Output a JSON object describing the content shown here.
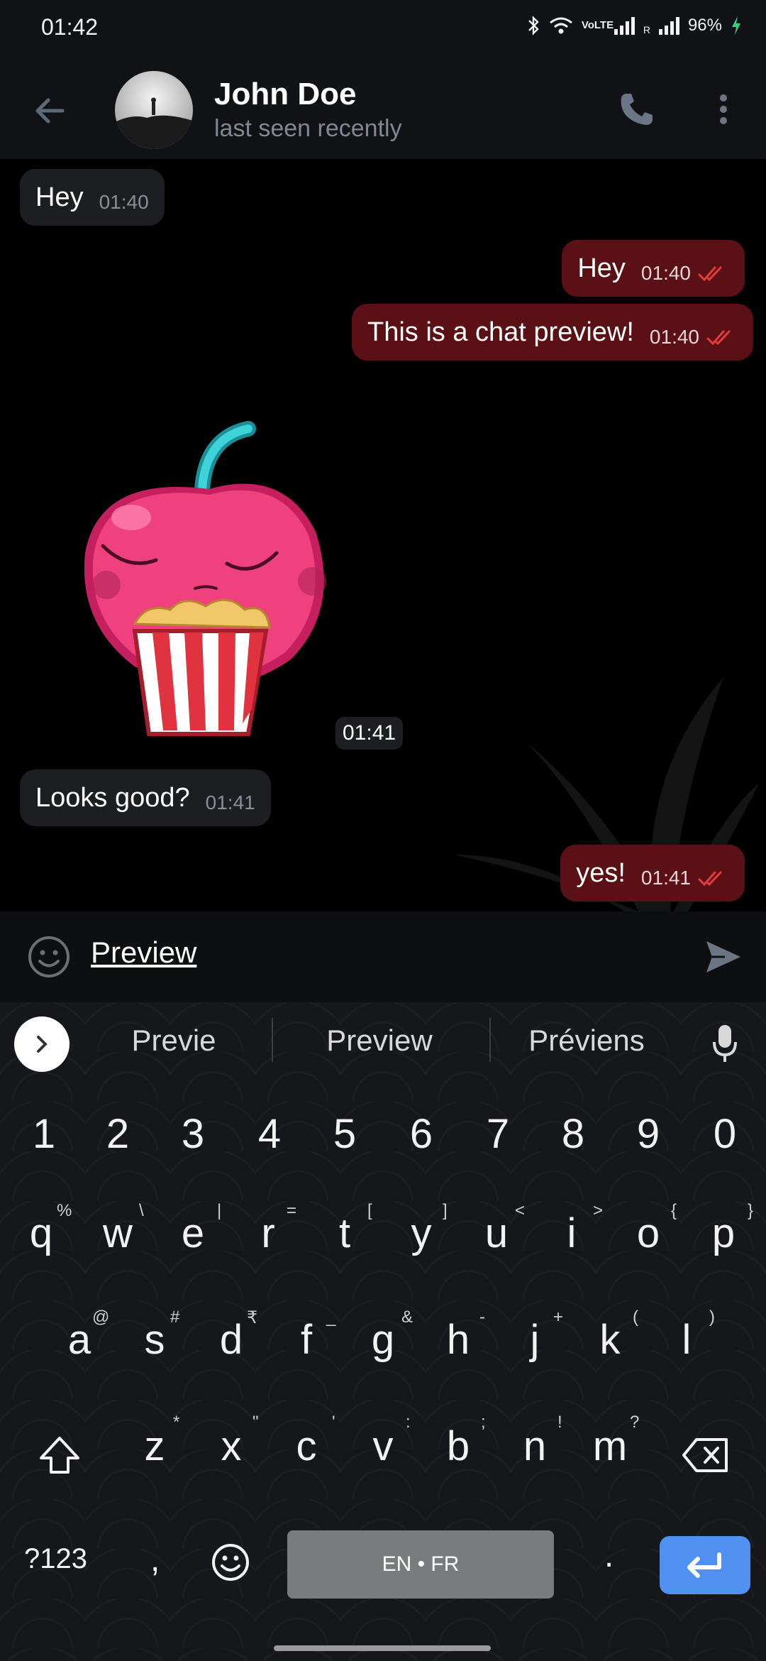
{
  "status_bar": {
    "time": "01:42",
    "network_label": "VoLTE",
    "roaming_label": "R",
    "battery": "96%"
  },
  "header": {
    "name": "John Doe",
    "status": "last seen recently"
  },
  "messages": [
    {
      "text": "Hey",
      "time": "01:40",
      "direction": "incoming"
    },
    {
      "text": "Hey",
      "time": "01:40",
      "direction": "outgoing"
    },
    {
      "text": "This is a chat preview!",
      "time": "01:40",
      "direction": "outgoing"
    },
    {
      "sticker": "cherry-popcorn-sticker",
      "time": "01:41",
      "direction": "incoming"
    },
    {
      "text": "Looks good?",
      "time": "01:41",
      "direction": "incoming"
    },
    {
      "text": "yes!",
      "time": "01:41",
      "direction": "outgoing"
    }
  ],
  "input": {
    "value": "Preview"
  },
  "keyboard": {
    "suggestions": [
      "Previe",
      "Preview",
      "Préviens"
    ],
    "row_numbers": [
      "1",
      "2",
      "3",
      "4",
      "5",
      "6",
      "7",
      "8",
      "9",
      "0"
    ],
    "row1": [
      "q",
      "w",
      "e",
      "r",
      "t",
      "y",
      "u",
      "i",
      "o",
      "p"
    ],
    "row1_hints": [
      "%",
      "\\",
      "|",
      "=",
      "[",
      "]",
      "<",
      ">",
      "{",
      "}"
    ],
    "row2": [
      "a",
      "s",
      "d",
      "f",
      "g",
      "h",
      "j",
      "k",
      "l"
    ],
    "row2_hints": [
      "@",
      "#",
      "₹",
      "_",
      "&",
      "-",
      "+",
      "(",
      ")"
    ],
    "row3": [
      "z",
      "x",
      "c",
      "v",
      "b",
      "n",
      "m"
    ],
    "row3_hints": [
      "*",
      "\"",
      "'",
      ":",
      ";",
      "!",
      "?"
    ],
    "symbols_label": "?123",
    "comma_label": ",",
    "period_label": ".",
    "space_label": "EN • FR"
  },
  "colors": {
    "outgoing_bubble": "#5a1015",
    "incoming_bubble": "#1d1e22",
    "accent": "#4f90f0"
  }
}
